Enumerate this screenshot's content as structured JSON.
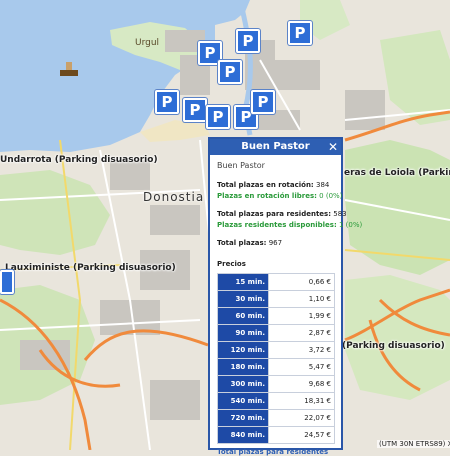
{
  "map": {
    "place_labels": [
      "Urgul",
      "Donostia /",
      "Undarrota (Parking disuasorio)",
      "Lauxiministe (Parking disuasorio)",
      "(Parking disuasorio)",
      "eras de Loiola (Parking disuaso"
    ],
    "credit": "(UTM 30N ETRS89) X",
    "parking_symbol": "P",
    "colors": {
      "sea": "#a8c9ec",
      "land": "#e9e5dc",
      "green": "#cbe3b3",
      "motorway": "#f08a3c",
      "parking": "#2d6dd6"
    }
  },
  "popup": {
    "title": "Buen Pastor",
    "close_icon": "close-icon",
    "name": "Buen Pastor",
    "rotation_total_label": "Total plazas en rotación:",
    "rotation_total_value": "384",
    "rotation_free_label": "Plazas en rotación libres:",
    "rotation_free_value": "0 (0%)",
    "residents_total_label": "Total plazas para residentes:",
    "residents_total_value": "583",
    "residents_free_label": "Plazas residentes disponibles:",
    "residents_free_value": "1 (0%)",
    "total_label": "Total plazas:",
    "total_value": "967",
    "prices_label": "Precios",
    "prices": [
      {
        "time": "15 min.",
        "price": "0,66 €"
      },
      {
        "time": "30 min.",
        "price": "1,10 €"
      },
      {
        "time": "60 min.",
        "price": "1,99 €"
      },
      {
        "time": "90 min.",
        "price": "2,87 €"
      },
      {
        "time": "120 min.",
        "price": "3,72 €"
      },
      {
        "time": "180 min.",
        "price": "5,47 €"
      },
      {
        "time": "300 min.",
        "price": "9,68 €"
      },
      {
        "time": "540 min.",
        "price": "18,31 €"
      },
      {
        "time": "720 min.",
        "price": "22,07 €"
      },
      {
        "time": "840 min.",
        "price": "24,57 €"
      }
    ],
    "footer": "Total plazas para residentes"
  }
}
